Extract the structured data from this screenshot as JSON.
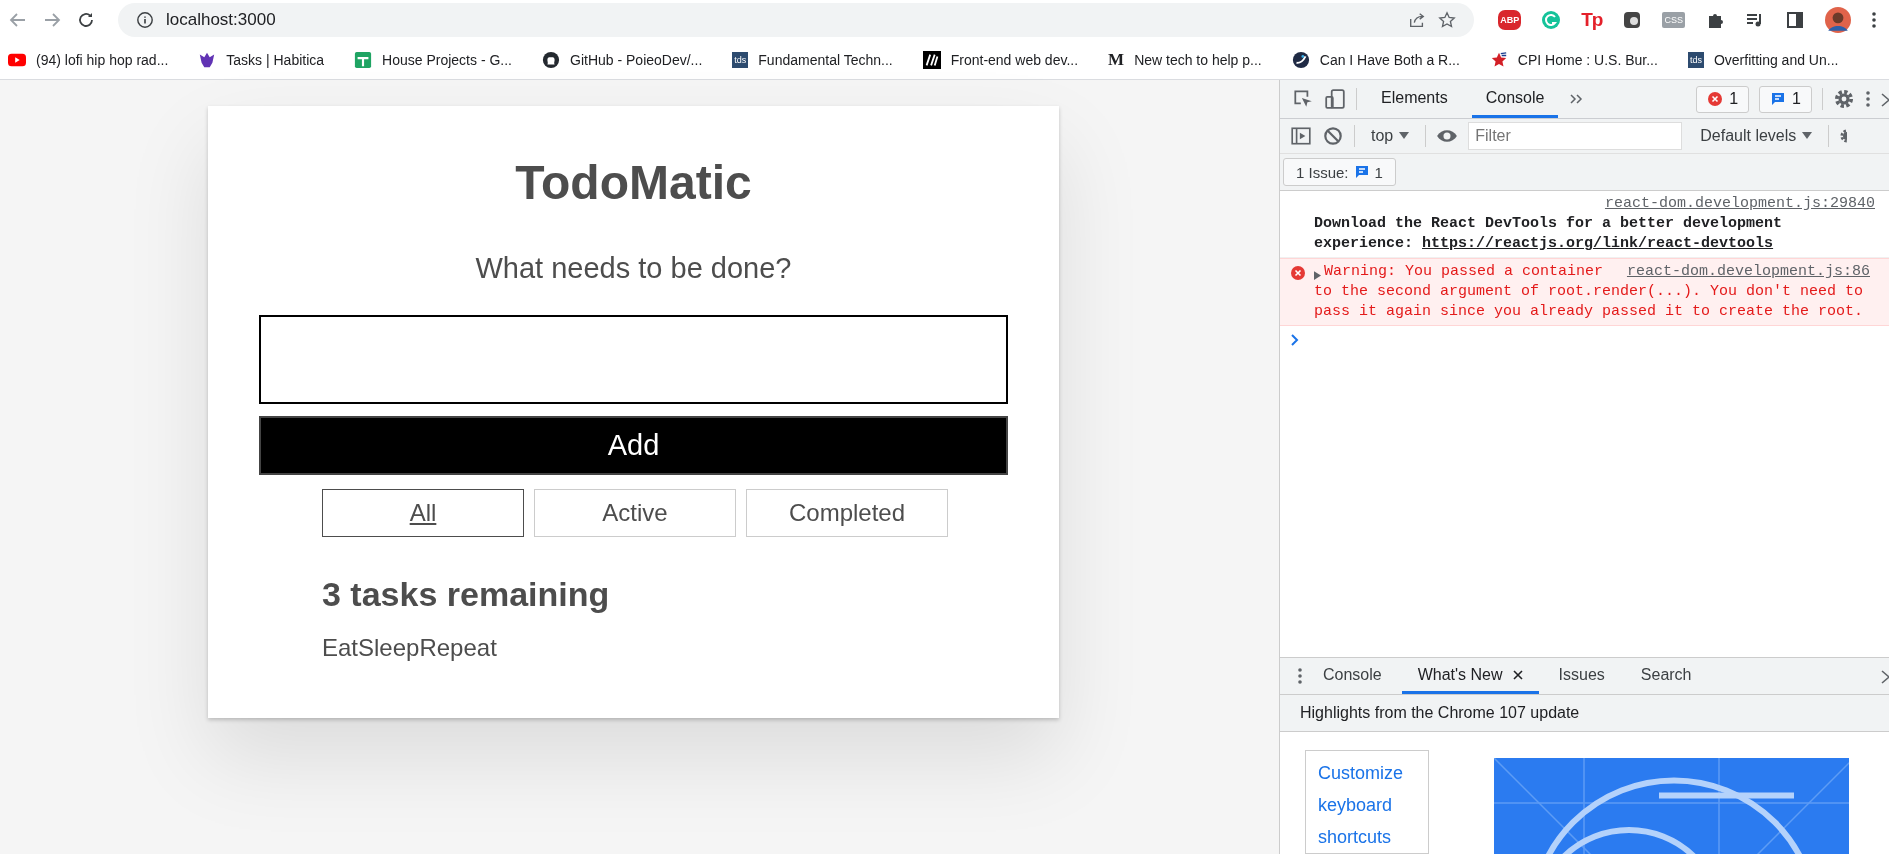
{
  "browser": {
    "url": "localhost:3000",
    "bookmarks": [
      {
        "label": "(94) lofi hip hop rad...",
        "icon": {
          "kind": "play"
        }
      },
      {
        "label": "Tasks | Habitica",
        "icon": {
          "kind": "creature"
        }
      },
      {
        "label": "House Projects - G...",
        "icon": {
          "kind": "sheet"
        }
      },
      {
        "label": "GitHub - PoieoDev/...",
        "icon": {
          "kind": "cat"
        }
      },
      {
        "label": "Fundamental Techn...",
        "icon": {
          "kind": "badge",
          "text": "tds"
        }
      },
      {
        "label": "Front-end web dev...",
        "icon": {
          "kind": "slashes"
        }
      },
      {
        "label": "New tech to help p...",
        "icon": {
          "kind": "letter",
          "text": "M"
        }
      },
      {
        "label": "Can I Have Both a R...",
        "icon": {
          "kind": "disc"
        }
      },
      {
        "label": "CPI Home : U.S. Bur...",
        "icon": {
          "kind": "star"
        }
      },
      {
        "label": "Overfitting and Un...",
        "icon": {
          "kind": "badge",
          "text": "tds"
        }
      }
    ],
    "extensions": [
      {
        "kind": "octagon",
        "text": "ABP"
      },
      {
        "kind": "ring"
      },
      {
        "kind": "text",
        "text": "Tp"
      },
      {
        "kind": "square"
      },
      {
        "kind": "css",
        "text": "CSS"
      },
      {
        "kind": "puzzle"
      },
      {
        "kind": "playlist"
      },
      {
        "kind": "sidebar"
      },
      {
        "kind": "avatar"
      }
    ]
  },
  "app": {
    "title": "TodoMatic",
    "prompt": "What needs to be done?",
    "add_button": "Add",
    "filters": [
      {
        "label": "All",
        "selected": true
      },
      {
        "label": "Active",
        "selected": false
      },
      {
        "label": "Completed",
        "selected": false
      }
    ],
    "remaining": "3 tasks remaining",
    "tasks": [
      "EatSleepRepeat"
    ]
  },
  "devtools": {
    "tabs": [
      {
        "label": "Elements",
        "selected": false
      },
      {
        "label": "Console",
        "selected": true
      }
    ],
    "error_count": "1",
    "message_count": "1",
    "context": "top",
    "filter_placeholder": "Filter",
    "levels": "Default levels",
    "issues": {
      "label": "1 Issue:",
      "count": "1"
    },
    "messages": [
      {
        "kind": "info",
        "source": "react-dom.development.js:29840",
        "text": "Download the React DevTools for a better development experience: ",
        "link": "https://reactjs.org/link/react-devtools"
      },
      {
        "kind": "error",
        "source": "react-dom.development.js:86",
        "text": "Warning: You passed a container",
        "detail": "to the second argument of root.render(...). You don't need to pass it again since you already passed it to create the root."
      }
    ],
    "drawer": {
      "tabs": [
        {
          "label": "Console",
          "selected": false,
          "closable": false
        },
        {
          "label": "What's New",
          "selected": true,
          "closable": true
        },
        {
          "label": "Issues",
          "selected": false,
          "closable": false
        },
        {
          "label": "Search",
          "selected": false,
          "closable": false
        }
      ],
      "headline": "Highlights from the Chrome 107 update",
      "link": "Customize keyboard shortcuts"
    }
  }
}
